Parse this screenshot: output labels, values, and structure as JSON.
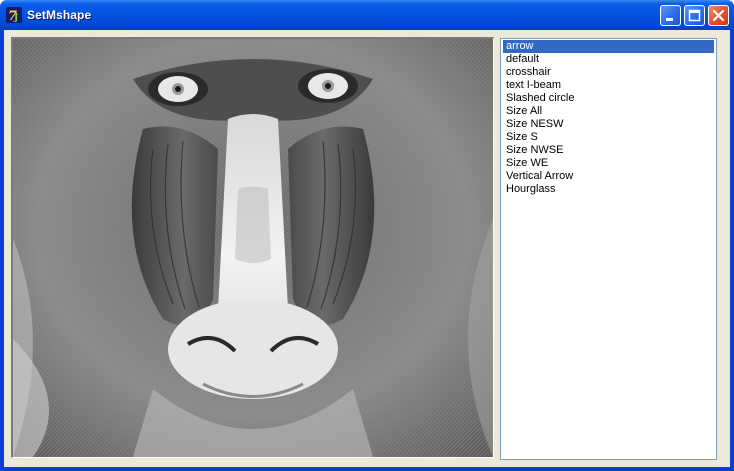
{
  "window": {
    "title": "SetMshape",
    "icon": "app-logo-icon"
  },
  "titlebar_buttons": [
    {
      "name": "minimize-button",
      "icon": "minimize-icon"
    },
    {
      "name": "maximize-button",
      "icon": "maximize-icon"
    },
    {
      "name": "close-button",
      "icon": "close-icon"
    }
  ],
  "picture": {
    "subject": "grayscale mandrill face photo"
  },
  "listbox": {
    "items": [
      "arrow",
      "default",
      "crosshair",
      "text I-beam",
      "Slashed circle",
      "Size All",
      "Size NESW",
      "Size S",
      "Size NWSE",
      "Size WE",
      "Vertical Arrow",
      "Hourglass"
    ],
    "selected": "arrow"
  },
  "colors": {
    "titlebar": "#0453e0",
    "selection": "#316ac5",
    "client_bg": "#ece9d8",
    "close_button": "#e4502a"
  }
}
